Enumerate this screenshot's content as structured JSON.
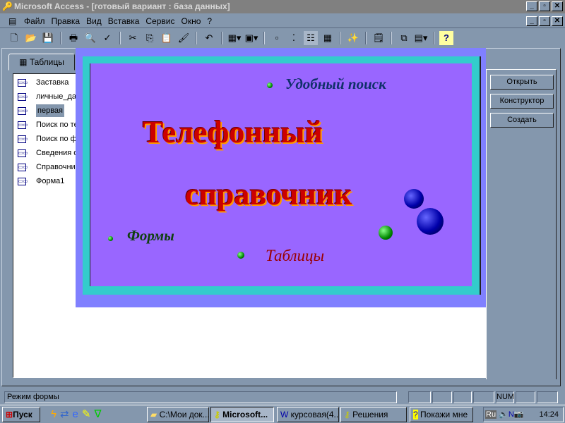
{
  "window": {
    "title": "Microsoft Access - [готовый вариант : база данных]",
    "min": "_",
    "restore": "▫",
    "close": "✕"
  },
  "menu": [
    "Файл",
    "Правка",
    "Вид",
    "Вставка",
    "Сервис",
    "Окно",
    "?"
  ],
  "db": {
    "tab": "Таблицы",
    "items": [
      "Заставка",
      "личные_да",
      "первая",
      "Поиск по те",
      "Поиск по ф",
      "Сведения о",
      "Справочни",
      "Форма1"
    ],
    "selected": "первая",
    "buttons": {
      "open": "Открыть",
      "design": "Конструктор",
      "create": "Создать"
    }
  },
  "splash": {
    "line1": "Телефонный",
    "line2": "справочник",
    "search": "Удобный поиск",
    "forms": "Формы",
    "tables": "Таблицы"
  },
  "status": {
    "text": "Режим формы",
    "num": "NUM"
  },
  "taskbar": {
    "start": "Пуск",
    "tasks": [
      "C:\\Мои док...",
      "Microsoft...",
      "курсовая(4...",
      "Решения",
      "Покажи мне"
    ],
    "lang": "Ru",
    "time": "14:24"
  }
}
